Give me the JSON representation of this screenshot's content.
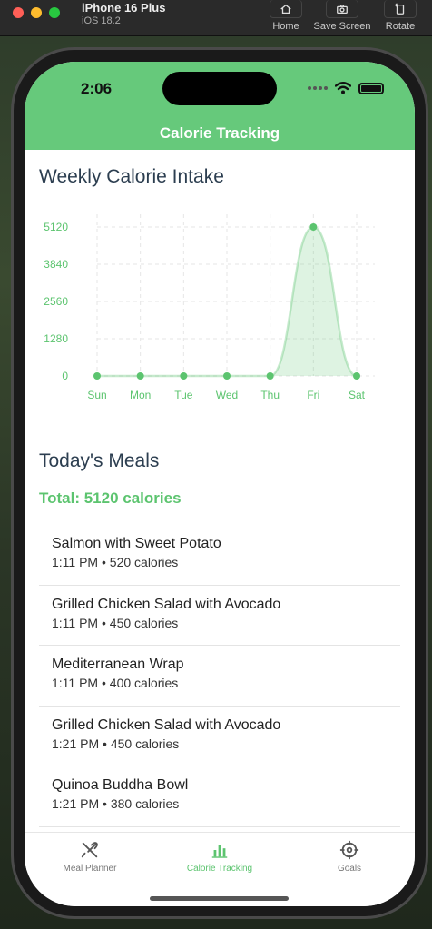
{
  "simulator": {
    "device": "iPhone 16 Plus",
    "os": "iOS 18.2",
    "buttons": [
      {
        "label": "Home",
        "icon": "home-icon"
      },
      {
        "label": "Save Screen",
        "icon": "camera-icon"
      },
      {
        "label": "Rotate",
        "icon": "rotate-icon"
      }
    ]
  },
  "status": {
    "time": "2:06"
  },
  "nav": {
    "title": "Calorie Tracking"
  },
  "weekly": {
    "title": "Weekly Calorie Intake"
  },
  "chart_data": {
    "type": "area",
    "categories": [
      "Sun",
      "Mon",
      "Tue",
      "Wed",
      "Thu",
      "Fri",
      "Sat"
    ],
    "values": [
      0,
      0,
      0,
      0,
      0,
      5120,
      0
    ],
    "yticks": [
      0,
      1280,
      2560,
      3840,
      5120
    ],
    "ylim": [
      0,
      5120
    ],
    "grid": true,
    "color": "#5cc46f"
  },
  "meals": {
    "title": "Today's Meals",
    "total": "Total: 5120 calories",
    "items": [
      {
        "name": "Salmon with Sweet Potato",
        "meta": "1:11 PM • 520 calories"
      },
      {
        "name": "Grilled Chicken Salad with Avocado",
        "meta": "1:11 PM • 450 calories"
      },
      {
        "name": "Mediterranean Wrap",
        "meta": "1:11 PM • 400 calories"
      },
      {
        "name": "Grilled Chicken Salad with Avocado",
        "meta": "1:21 PM • 450 calories"
      },
      {
        "name": "Quinoa Buddha Bowl",
        "meta": "1:21 PM • 380 calories"
      }
    ]
  },
  "tabs": [
    {
      "label": "Meal Planner",
      "icon": "utensils-icon",
      "active": false
    },
    {
      "label": "Calorie Tracking",
      "icon": "bar-chart-icon",
      "active": true
    },
    {
      "label": "Goals",
      "icon": "crosshair-icon",
      "active": false
    }
  ],
  "colors": {
    "accent": "#5cc46f",
    "header": "#66c97b",
    "heading": "#2c3e50"
  }
}
